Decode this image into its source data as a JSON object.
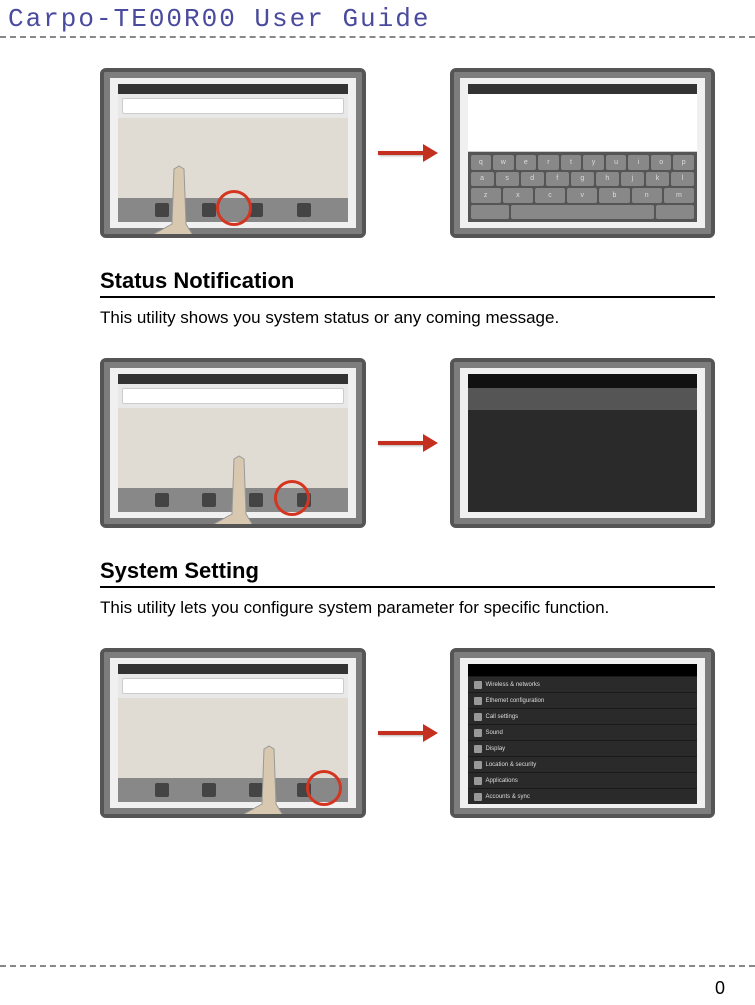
{
  "header": {
    "title": "Carpo-TE00R00  User  Guide"
  },
  "sections": {
    "status_notification": {
      "title": "Status Notification",
      "text": "This utility shows you system status or any coming message."
    },
    "system_setting": {
      "title": "System Setting",
      "text": "This utility lets you configure system parameter for specific function."
    }
  },
  "keyboard": {
    "row1": [
      "q",
      "w",
      "e",
      "r",
      "t",
      "y",
      "u",
      "i",
      "o",
      "p"
    ],
    "row2": [
      "a",
      "s",
      "d",
      "f",
      "g",
      "h",
      "j",
      "k",
      "l"
    ],
    "row3": [
      "z",
      "x",
      "c",
      "v",
      "b",
      "n",
      "m"
    ]
  },
  "settings_items": [
    "Wireless & networks",
    "Ethernet configuration",
    "Call settings",
    "Sound",
    "Display",
    "Location & security",
    "Applications",
    "Accounts & sync"
  ],
  "page_number": "0"
}
